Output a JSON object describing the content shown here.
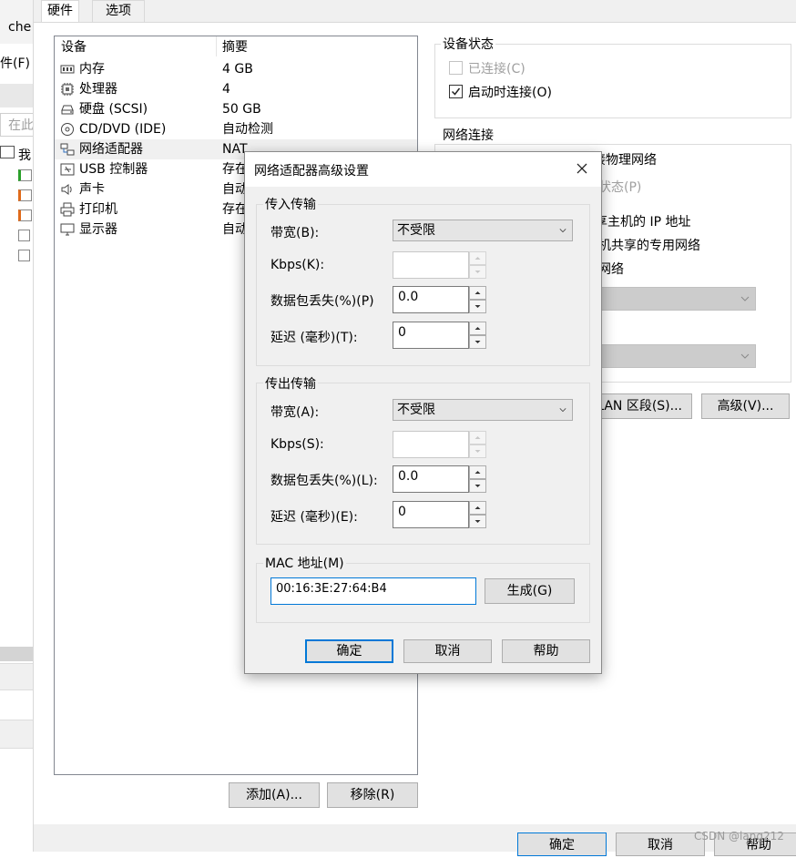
{
  "background_app": {
    "fragments": [
      "che",
      "件(F)",
      "在此",
      "我"
    ]
  },
  "settings": {
    "tabs": [
      {
        "label": "硬件"
      },
      {
        "label": "选项"
      }
    ],
    "device_list": {
      "headers": {
        "device": "设备",
        "summary": "摘要"
      },
      "rows": [
        {
          "name": "内存",
          "summary": "4 GB",
          "icon": "memory-icon"
        },
        {
          "name": "处理器",
          "summary": "4",
          "icon": "cpu-icon"
        },
        {
          "name": "硬盘 (SCSI)",
          "summary": "50 GB",
          "icon": "harddisk-icon"
        },
        {
          "name": "CD/DVD (IDE)",
          "summary": "自动检测",
          "icon": "cdrom-icon"
        },
        {
          "name": "网络适配器",
          "summary": "NAT",
          "icon": "network-adapter-icon"
        },
        {
          "name": "USB 控制器",
          "summary": "存在",
          "icon": "usb-icon"
        },
        {
          "name": "声卡",
          "summary": "自动",
          "icon": "speaker-icon"
        },
        {
          "name": "打印机",
          "summary": "存在",
          "icon": "printer-icon"
        },
        {
          "name": "显示器",
          "summary": "自动",
          "icon": "monitor-icon"
        }
      ],
      "selected_index": 4
    },
    "add_button": "添加(A)...",
    "remove_button": "移除(R)",
    "device_status": {
      "title": "设备状态",
      "connected": {
        "label": "已连接(C)",
        "checked": false,
        "enabled": false
      },
      "connect_at_power_on": {
        "label": "启动时连接(O)",
        "checked": true,
        "enabled": true
      }
    },
    "network_connection": {
      "title": "网络连接",
      "fragments": [
        "接物理网络",
        "状态(P)",
        "享主机的 IP 地址",
        "机共享的专用网络",
        "网络"
      ]
    },
    "lan_segment_button": "LAN 区段(S)...",
    "advanced_button": "高级(V)...",
    "footer": {
      "ok": "确定",
      "cancel": "取消",
      "help": "帮助"
    }
  },
  "dialog": {
    "title": "网络适配器高级设置",
    "incoming": {
      "title": "传入传输",
      "bandwidth_label": "带宽(B):",
      "bandwidth_value": "不受限",
      "kbps_label": "Kbps(K):",
      "kbps_value": "",
      "packet_loss_label": "数据包丢失(%)(P)",
      "packet_loss_value": "0.0",
      "latency_label": "延迟 (毫秒)(T):",
      "latency_value": "0"
    },
    "outgoing": {
      "title": "传出传输",
      "bandwidth_label": "带宽(A):",
      "bandwidth_value": "不受限",
      "kbps_label": "Kbps(S):",
      "kbps_value": "",
      "packet_loss_label": "数据包丢失(%)(L):",
      "packet_loss_value": "0.0",
      "latency_label": "延迟 (毫秒)(E):",
      "latency_value": "0"
    },
    "mac": {
      "title": "MAC 地址(M)",
      "value": "00:16:3E:27:64:B4",
      "generate_button": "生成(G)"
    },
    "buttons": {
      "ok": "确定",
      "cancel": "取消",
      "help": "帮助"
    }
  },
  "watermark": "CSDN @lang212",
  "colors": {
    "focus_blue": "#0078d7",
    "window_bg": "#f0f0f0",
    "disabled_text": "#a0a0a0"
  }
}
